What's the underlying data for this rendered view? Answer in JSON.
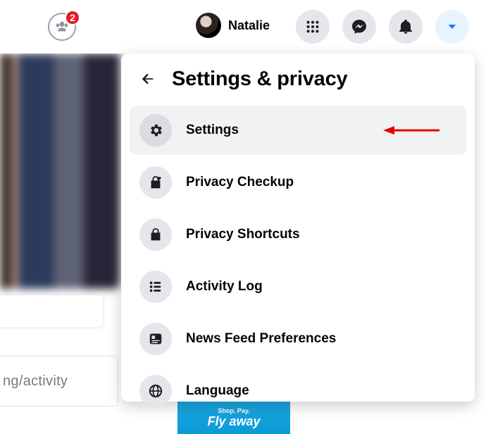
{
  "header": {
    "friends_badge": "2",
    "profile_name": "Natalie"
  },
  "panel": {
    "title": "Settings & privacy",
    "items": [
      {
        "label": "Settings"
      },
      {
        "label": "Privacy Checkup"
      },
      {
        "label": "Privacy Shortcuts"
      },
      {
        "label": "Activity Log"
      },
      {
        "label": "News Feed Preferences"
      },
      {
        "label": "Language"
      }
    ]
  },
  "background": {
    "partial_link": "ng/activity",
    "ad_line1": "Shop. Pay.",
    "ad_line2": "Fly away"
  }
}
